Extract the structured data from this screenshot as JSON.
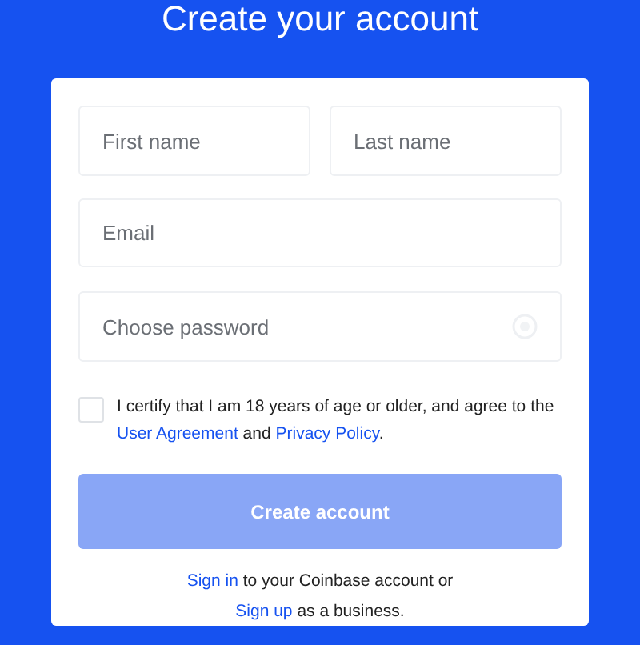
{
  "title": "Create your account",
  "name_fields": [
    {
      "placeholder": "First name"
    },
    {
      "placeholder": "Last name"
    }
  ],
  "email_field": {
    "placeholder": "Email"
  },
  "password_field": {
    "placeholder": "Choose password"
  },
  "certify": {
    "checked": false,
    "parts": [
      {
        "text": "I certify that I am 18 years of age or older, and agree to the ",
        "link": false
      },
      {
        "text": "User Agreement",
        "link": true
      },
      {
        "text": " and ",
        "link": false
      },
      {
        "text": "Privacy Policy",
        "link": true
      },
      {
        "text": ".",
        "link": false
      }
    ]
  },
  "submit_button": {
    "label": "Create account",
    "disabled": true
  },
  "footer_lines": [
    [
      {
        "text": "Sign in",
        "link": true
      },
      {
        "text": " to your Coinbase account or",
        "link": false
      }
    ],
    [
      {
        "text": "Sign up",
        "link": true
      },
      {
        "text": " as a business.",
        "link": false
      }
    ]
  ]
}
